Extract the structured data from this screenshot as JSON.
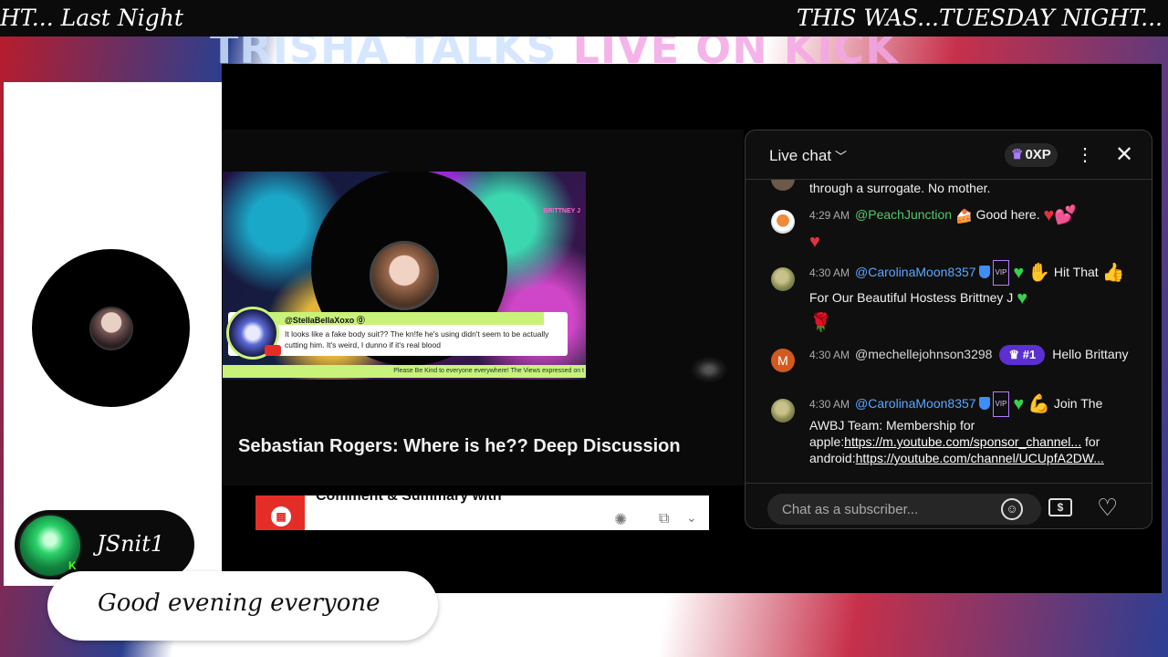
{
  "ticker": {
    "left_text": "HT... Last Night",
    "right_text": "THIS WAS...TUESDAY NIGHT..."
  },
  "banner": {
    "part1": "TRISHA TALKS ",
    "part2": "LIVE ON KICK"
  },
  "video": {
    "title": "Sebastian Rogers: Where is he?? Deep Discussion",
    "thumbnail": {
      "corner_label": "BRITTNEY J",
      "comment_handle": "@StellaBellaXoxo ⓪",
      "comment_text": "It looks like a fake body suit?? The kn!fe he's using didn't seem to be actually cutting him. It's weird, I dunno if it's real blood",
      "footer_text": "Please Be Kind to everyone everywhere! The Views expressed on t"
    },
    "plugin": {
      "label": "Comment & Summary with",
      "logo_icon": "grid-icon",
      "ai_icon": "openai-icon",
      "copy_icon": "copy-icon",
      "chevron_icon": "chevron-down-icon"
    }
  },
  "chat": {
    "title": "Live chat",
    "xp": "0XP",
    "placeholder": "Chat as a subscriber...",
    "messages": [
      {
        "time": "",
        "author": "",
        "text": "through a surrogate. No mother."
      },
      {
        "time": "4:29 AM",
        "author": "@PeachJunction",
        "text": "Good here."
      },
      {
        "time": "4:30 AM",
        "author": "@CarolinaMoon8357",
        "text": "Hit That",
        "text2": "For Our Beautiful Hostess Brittney J"
      },
      {
        "time": "4:30 AM",
        "author": "@mechellejohnson3298",
        "rank": "#1",
        "text": "Hello Brittany"
      },
      {
        "time": "4:30 AM",
        "author": "@CarolinaMoon8357",
        "text": "Join The AWBJ Team: Membership for apple:",
        "link1": "https://m.youtube.com/sponsor_channel...",
        "mid": " for android:",
        "link2": "https://youtube.com/channel/UCUpfA2DW..."
      }
    ]
  },
  "overlay": {
    "username": "JSnit1",
    "message": "Good evening everyone",
    "platform_badge": "K"
  },
  "colors": {
    "kick_green": "#53fc18",
    "chat_green_author": "#55c66b",
    "chat_blue_author": "#5aa7ff",
    "rank_purple": "#5b2fd0",
    "youtube_red": "#e52d27"
  }
}
